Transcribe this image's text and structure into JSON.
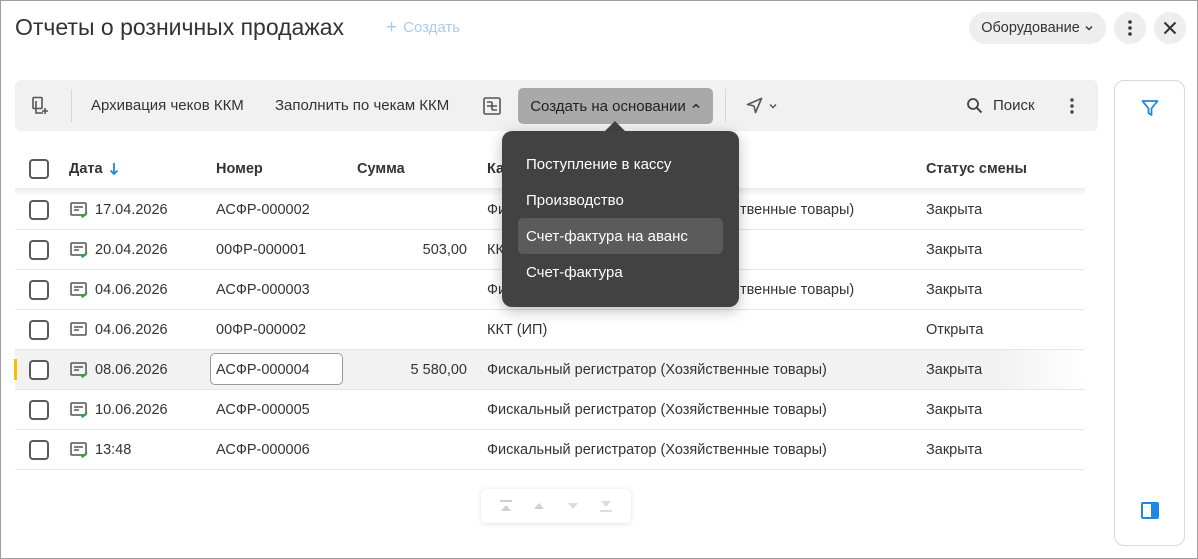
{
  "header": {
    "title": "Отчеты о розничных продажах",
    "create_label": "Создать",
    "equipment_label": "Оборудование"
  },
  "toolbar": {
    "archive_label": "Архивация чеков ККМ",
    "fill_label": "Заполнить по чекам ККМ",
    "create_based_label": "Создать на основании",
    "search_label": "Поиск"
  },
  "dropdown_menu": {
    "items": [
      "Поступление в кассу",
      "Производство",
      "Счет-фактура на аванс",
      "Счет-фактура"
    ],
    "highlighted": "Счет-фактура на аванс"
  },
  "table": {
    "columns": [
      "Дата",
      "Номер",
      "Сумма",
      "Ка",
      "Статус смены"
    ],
    "sort_column": "Дата",
    "rows": [
      {
        "date": "17.04.2026",
        "number": "АСФР-000002",
        "sum": "",
        "kassa": "Фи",
        "kassa_tail": "твенные товары)",
        "status": "Закрыта"
      },
      {
        "date": "20.04.2026",
        "number": "00ФР-000001",
        "sum": "503,00",
        "kassa": "КК",
        "kassa_tail": "",
        "status": "Закрыта"
      },
      {
        "date": "04.06.2026",
        "number": "АСФР-000003",
        "sum": "",
        "kassa": "Фи",
        "kassa_tail": "твенные товары)",
        "status": "Закрыта"
      },
      {
        "date": "04.06.2026",
        "number": "00ФР-000002",
        "sum": "",
        "kassa": "ККТ (ИП)",
        "kassa_tail": "",
        "status": "Открыта"
      },
      {
        "date": "08.06.2026",
        "number": "АСФР-000004",
        "sum": "5 580,00",
        "kassa": "Фискальный регистратор (Хозяйственные товары)",
        "kassa_tail": "",
        "status": "Закрыта"
      },
      {
        "date": "10.06.2026",
        "number": "АСФР-000005",
        "sum": "",
        "kassa": "Фискальный регистратор (Хозяйственные товары)",
        "kassa_tail": "",
        "status": "Закрыта"
      },
      {
        "date": "13:48",
        "number": "АСФР-000006",
        "sum": "",
        "kassa": "Фискальный регистратор (Хозяйственные товары)",
        "kassa_tail": "",
        "status": "Закрыта"
      }
    ]
  },
  "colors": {
    "accent": "#1e88e5",
    "current_row_marker": "#f2c200",
    "menu_bg": "#424242",
    "dropdown_active_bg": "#a9a9a9",
    "check_green": "#2e9e44"
  },
  "icons": {
    "copy": "copy-add-icon",
    "barcode": "scan-icon",
    "send": "send-icon",
    "search": "search-icon",
    "more": "more-vertical-icon",
    "close": "close-icon",
    "filter": "filter-icon",
    "panel": "panel-toggle-icon",
    "doc_status": "document-check-icon"
  }
}
